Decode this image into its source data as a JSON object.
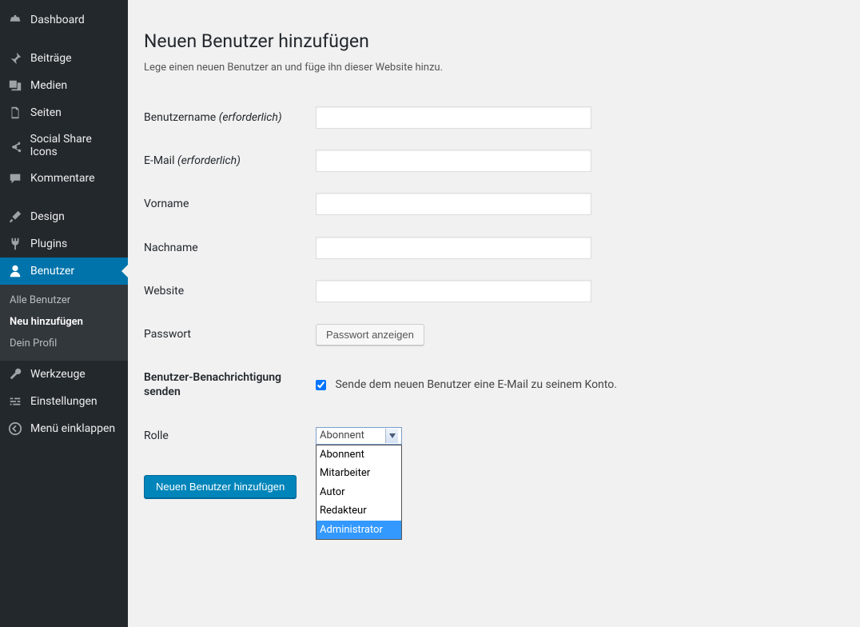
{
  "sidebar": {
    "items": [
      {
        "label": "Dashboard",
        "icon": "dashboard"
      },
      {
        "label": "Beiträge",
        "icon": "pin"
      },
      {
        "label": "Medien",
        "icon": "media"
      },
      {
        "label": "Seiten",
        "icon": "page"
      },
      {
        "label": "Social Share Icons",
        "icon": "share"
      },
      {
        "label": "Kommentare",
        "icon": "comment"
      },
      {
        "label": "Design",
        "icon": "brush"
      },
      {
        "label": "Plugins",
        "icon": "plug"
      },
      {
        "label": "Benutzer",
        "icon": "user"
      },
      {
        "label": "Werkzeuge",
        "icon": "wrench"
      },
      {
        "label": "Einstellungen",
        "icon": "sliders"
      },
      {
        "label": "Menü einklappen",
        "icon": "collapse"
      }
    ],
    "submenu": [
      {
        "label": "Alle Benutzer"
      },
      {
        "label": "Neu hinzufügen"
      },
      {
        "label": "Dein Profil"
      }
    ]
  },
  "page": {
    "title": "Neuen Benutzer hinzufügen",
    "intro": "Lege einen neuen Benutzer an und füge ihn dieser Website hinzu."
  },
  "form": {
    "username_label": "Benutzername",
    "required_text": "(erforderlich)",
    "email_label": "E-Mail",
    "firstname_label": "Vorname",
    "lastname_label": "Nachname",
    "website_label": "Website",
    "password_label": "Passwort",
    "show_password_btn": "Passwort anzeigen",
    "notify_label": "Benutzer-Benachrichtigung senden",
    "notify_checkbox_text": "Sende dem neuen Benutzer eine E-Mail zu seinem Konto.",
    "notify_checked": true,
    "role_label": "Rolle",
    "role_selected": "Abonnent",
    "role_options": [
      "Abonnent",
      "Mitarbeiter",
      "Autor",
      "Redakteur",
      "Administrator"
    ],
    "role_highlight_index": 4,
    "submit_label": "Neuen Benutzer hinzufügen",
    "values": {
      "username": "",
      "email": "",
      "firstname": "",
      "lastname": "",
      "website": ""
    }
  }
}
